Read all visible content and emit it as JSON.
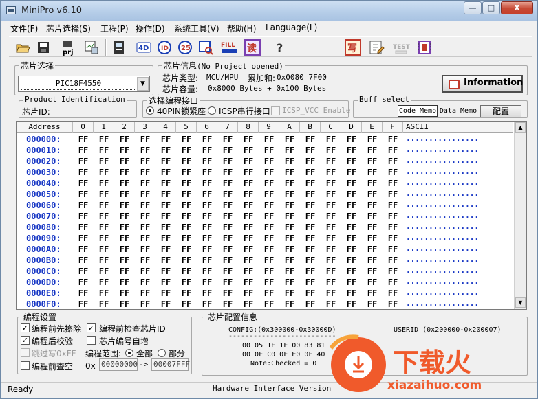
{
  "window": {
    "title": "MiniPro v6.10",
    "min_label": "—",
    "max_label": "□",
    "close_label": "X"
  },
  "menu": [
    "文件(F)",
    "芯片选择(S)",
    "工程(P)",
    "操作(D)",
    "系统工具(V)",
    "帮助(H)",
    "Language(L)"
  ],
  "toolbar": {
    "prj_label": "prj",
    "fill_label": "FILL",
    "read_label": "读",
    "help_label": "?",
    "write_label": "写",
    "test_label": "TEST",
    "icon_names": [
      "open-icon",
      "save-icon",
      "project-icon",
      "chip-view-icon",
      "save-chip-icon",
      "4d-icon",
      "read-id-icon",
      "erase-icon",
      "blank-check-icon",
      "fill-icon",
      "read-icon",
      "help-icon",
      "write-icon",
      "edit-icon",
      "test-icon",
      "chip-icon"
    ]
  },
  "chip_select": {
    "group_title": "芯片选择",
    "selected_chip": "PIC18F4550",
    "dropdown_arrow": "▼"
  },
  "chip_info": {
    "group_title": "芯片信息",
    "project_status": "(No Project opened)",
    "type_label": "芯片类型:",
    "type_value": "MCU/MPU",
    "checksum_label": "累加和:",
    "checksum_value": "0x0080 7F00",
    "capacity_label": "芯片容量:",
    "capacity_value": "0x8000 Bytes + 0x100 Bytes",
    "info_button": "Information"
  },
  "product_id": {
    "group_title": "Product Identification",
    "chip_id_label": "芯片ID:"
  },
  "interface": {
    "group_title": "选择编程接口",
    "opt_40pin": "40PIN锁紧座",
    "opt_icsp": "ICSP串行接口",
    "opt_icsp_vcc": "ICSP_VCC Enable"
  },
  "buff_select": {
    "group_title": "Buff select",
    "code_memo": "Code Memo",
    "data_memo": "Data Memo",
    "config": "配置"
  },
  "hex_grid": {
    "header_address": "Address",
    "header_cols": [
      "0",
      "1",
      "2",
      "3",
      "4",
      "5",
      "6",
      "7",
      "8",
      "9",
      "A",
      "B",
      "C",
      "D",
      "E",
      "F"
    ],
    "header_ascii": "ASCII",
    "addresses": [
      "000000:",
      "000010:",
      "000020:",
      "000030:",
      "000040:",
      "000050:",
      "000060:",
      "000070:",
      "000080:",
      "000090:",
      "0000A0:",
      "0000B0:",
      "0000C0:",
      "0000D0:",
      "0000E0:",
      "0000F0:"
    ],
    "cell_value": "FF",
    "ascii_value": "................",
    "scroll_up": "▲",
    "scroll_down": "▼"
  },
  "prog_settings": {
    "group_title": "编程设置",
    "erase_before": "编程前先擦除",
    "check_id": "编程前检查芯片ID",
    "verify_after": "编程后校验",
    "auto_increment": "芯片编号自增",
    "skip_0xff": "跳过写0xFF",
    "range_label": "编程范围:",
    "range_all": "全部",
    "range_part": "部分",
    "blank_check": "编程前查空",
    "hex_prefix": "0x",
    "start_addr": "00000000",
    "arrow": "->",
    "end_addr": "00007FFF",
    "check_mark": "✓"
  },
  "config_info": {
    "group_title": "芯片配置信息",
    "config_line": "CONFIG:(0x300000-0x30000D)",
    "config_dashes": "--------------------------",
    "config_bytes1": "00 05 1F 1F 00 83 81 ",
    "config_bytes2": "00 0F C0 0F E0 0F 40 ",
    "note": "Note:Checked = 0",
    "userid": "USERID (0x200000-0x200007)"
  },
  "status": {
    "left": "Ready",
    "center": "Hardware Interface Version"
  },
  "watermark": {
    "brand": "下载火",
    "url": "xiazaihuo.com"
  }
}
